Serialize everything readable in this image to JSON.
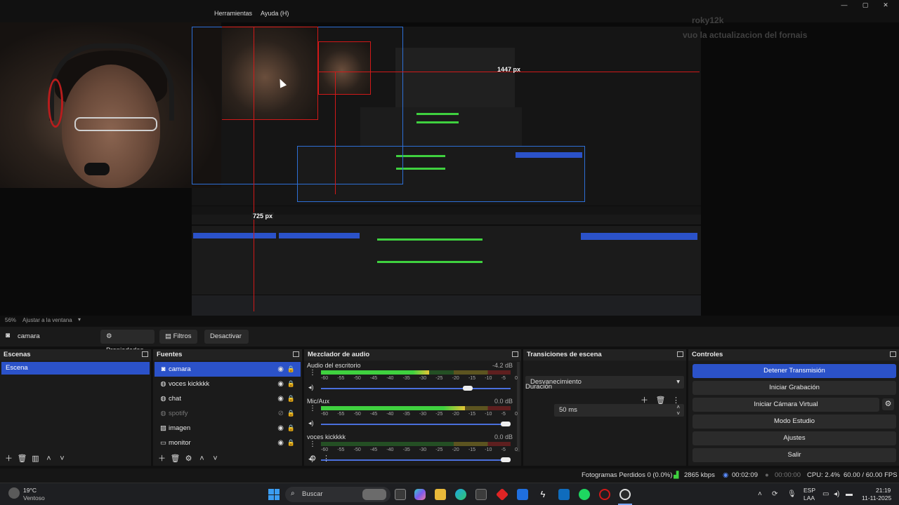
{
  "menu": {
    "items": [
      "Herramientas",
      "Ayuda (H)"
    ]
  },
  "window_controls": {
    "minimize": "—",
    "maximize": "▢",
    "close": "✕"
  },
  "preview": {
    "overlay_text_1": "roky12k",
    "overlay_text_2": "vuo la actualizacion del fornais",
    "measure_h": "1447 px",
    "measure_v": "725 px"
  },
  "zoom": {
    "value": "56%",
    "label": "Ajustar a la ventana"
  },
  "source_toolbar": {
    "source_name": "camara",
    "properties": "Propiedades",
    "filters": "Filtros",
    "deactivate": "Desactivar"
  },
  "scenes": {
    "title": "Escenas",
    "items": [
      "Escena"
    ]
  },
  "sources": {
    "title": "Fuentes",
    "items": [
      "camara",
      "voces kickkkk",
      "chat",
      "spotify",
      "imagen",
      "monitor"
    ]
  },
  "mixer": {
    "title": "Mezclador de audio",
    "scale": [
      "-60",
      "-55",
      "-50",
      "-45",
      "-40",
      "-35",
      "-30",
      "-25",
      "-20",
      "-15",
      "-10",
      "-5",
      "0"
    ],
    "channels": [
      {
        "name": "Audio del escritorio",
        "db": "-4.2 dB",
        "level": 0.57,
        "volume": 0.8
      },
      {
        "name": "Mic/Aux",
        "db": "0.0 dB",
        "level": 0.76,
        "volume": 1.0
      },
      {
        "name": "voces kickkkk",
        "db": "0.0 dB",
        "level": 0.0,
        "volume": 1.0
      }
    ]
  },
  "transitions": {
    "title": "Transiciones de escena",
    "selected": "Desvanecimiento",
    "duration_label": "Duración",
    "duration_value": "50 ms"
  },
  "controls": {
    "title": "Controles",
    "stop_stream": "Detener Transmisión",
    "start_recording": "Iniciar Grabación",
    "start_virtual_cam": "Iniciar Cámara Virtual",
    "studio_mode": "Modo Estudio",
    "settings": "Ajustes",
    "exit": "Salir"
  },
  "status": {
    "dropped_frames": "Fotogramas Perdidos 0 (0.0%)",
    "bitrate": "2865 kbps",
    "stream_time": "00:02:09",
    "rec_time": "00:00:00",
    "cpu": "CPU: 2.4%",
    "fps": "60.00 / 60.00 FPS"
  },
  "taskbar": {
    "weather_temp": "19°C",
    "weather_desc": "Ventoso",
    "search": "Buscar",
    "lang_1": "ESP",
    "lang_2": "LAA",
    "time": "21:19",
    "date": "11-11-2025"
  },
  "colors": {
    "accent": "#2b52c9",
    "meter_green": "#3fd13f",
    "guide_red": "#d11919",
    "guide_blue": "#2d6fd6"
  }
}
